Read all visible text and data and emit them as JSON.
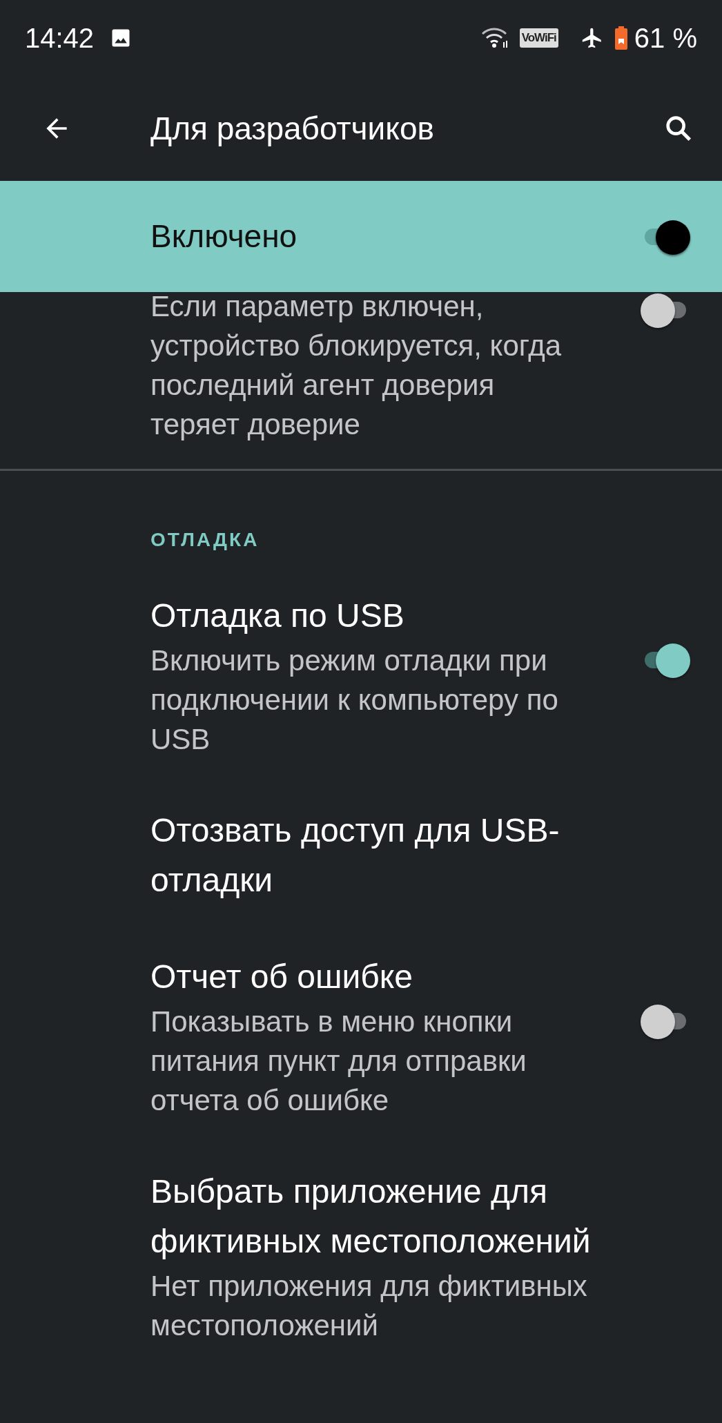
{
  "status_bar": {
    "time": "14:42",
    "network_badge": "VoWiFi",
    "battery_percent": "61 %"
  },
  "app_bar": {
    "title": "Для разработчиков"
  },
  "master_switch": {
    "label": "Включено",
    "on": true
  },
  "list": [
    {
      "kind": "switch",
      "summary": "Если параметр включен, устройство блокируется, когда последний агент доверия теряет доверие",
      "on": false
    },
    {
      "kind": "header",
      "title": "ОТЛАДКА"
    },
    {
      "kind": "switch",
      "title": "Отладка по USB",
      "summary": "Включить режим отладки при подключении к компьютеру по USB",
      "on": true
    },
    {
      "kind": "plain",
      "title": "Отозвать доступ для USB-отладки"
    },
    {
      "kind": "switch",
      "title": "Отчет об ошибке",
      "summary": "Показывать в меню кнопки питания пункт для отправки отчета об ошибке",
      "on": false
    },
    {
      "kind": "plain",
      "title": "Выбрать приложение для фиктивных местоположений",
      "summary": "Нет приложения для фиктивных местоположений"
    }
  ]
}
